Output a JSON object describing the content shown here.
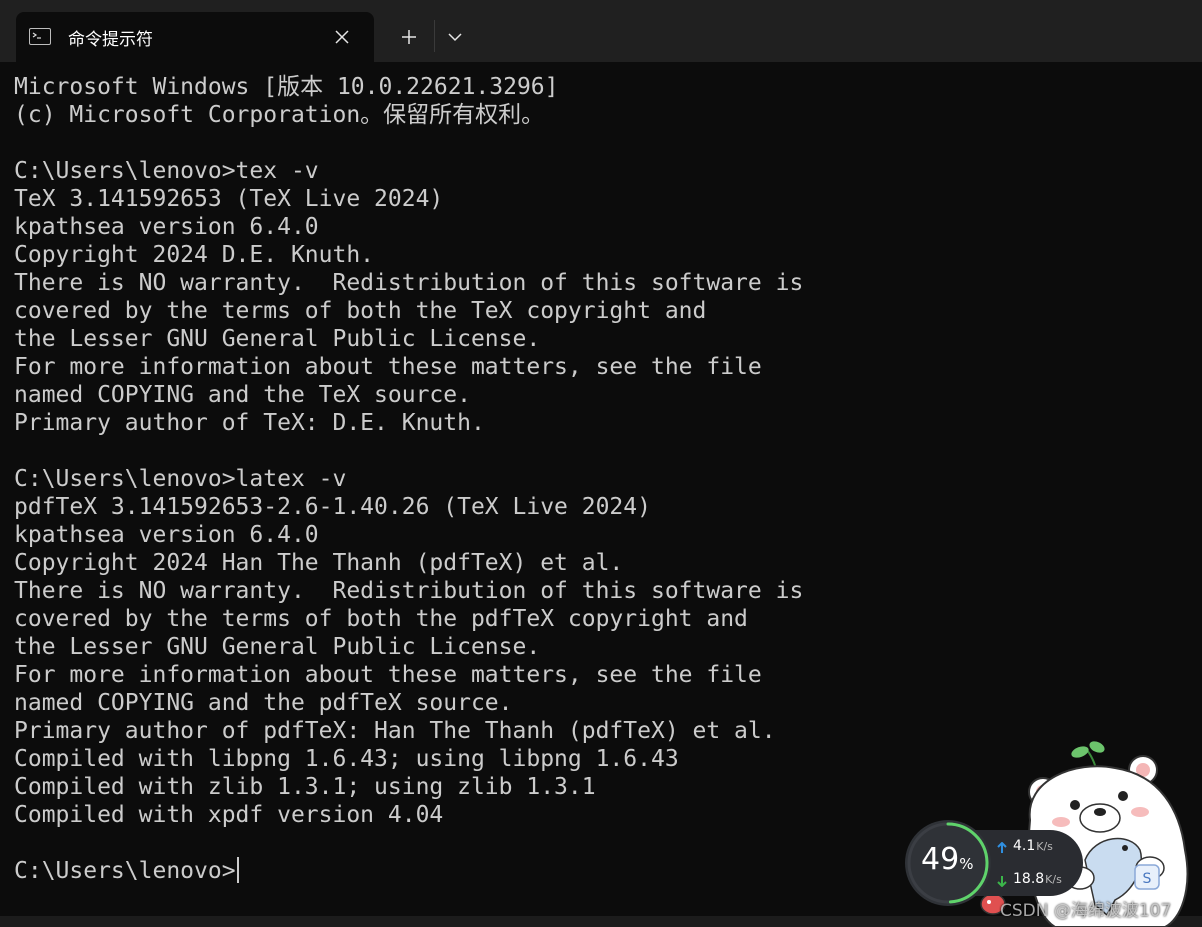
{
  "window": {
    "tab_title": "命令提示符",
    "tab_icon": "terminal-icon",
    "close_icon": "close-icon",
    "new_tab_icon": "plus-icon",
    "dropdown_icon": "chevron-down-icon"
  },
  "terminal": {
    "lines": [
      "Microsoft Windows [版本 10.0.22621.3296]",
      "(c) Microsoft Corporation。保留所有权利。",
      "",
      "C:\\Users\\lenovo>tex -v",
      "TeX 3.141592653 (TeX Live 2024)",
      "kpathsea version 6.4.0",
      "Copyright 2024 D.E. Knuth.",
      "There is NO warranty.  Redistribution of this software is",
      "covered by the terms of both the TeX copyright and",
      "the Lesser GNU General Public License.",
      "For more information about these matters, see the file",
      "named COPYING and the TeX source.",
      "Primary author of TeX: D.E. Knuth.",
      "",
      "C:\\Users\\lenovo>latex -v",
      "pdfTeX 3.141592653-2.6-1.40.26 (TeX Live 2024)",
      "kpathsea version 6.4.0",
      "Copyright 2024 Han The Thanh (pdfTeX) et al.",
      "There is NO warranty.  Redistribution of this software is",
      "covered by the terms of both the pdfTeX copyright and",
      "the Lesser GNU General Public License.",
      "For more information about these matters, see the file",
      "named COPYING and the pdfTeX source.",
      "Primary author of pdfTeX: Han The Thanh (pdfTeX) et al.",
      "Compiled with libpng 1.6.43; using libpng 1.6.43",
      "Compiled with zlib 1.3.1; using zlib 1.3.1",
      "Compiled with xpdf version 4.04",
      ""
    ],
    "prompt": "C:\\Users\\lenovo>",
    "foreground_color": "#cccccc",
    "background_color": "#0c0c0c"
  },
  "net_monitor": {
    "percent": "49",
    "percent_sign": "%",
    "percent_fraction": 0.49,
    "upload_value": "4.1",
    "upload_unit": "K/s",
    "download_value": "18.8",
    "download_unit": "K/s",
    "ring_color": "#5fd36b",
    "upload_arrow_color": "#2f8fe0",
    "download_arrow_color": "#3bb54a"
  },
  "watermark": {
    "text": "CSDN @海绵波波107"
  }
}
